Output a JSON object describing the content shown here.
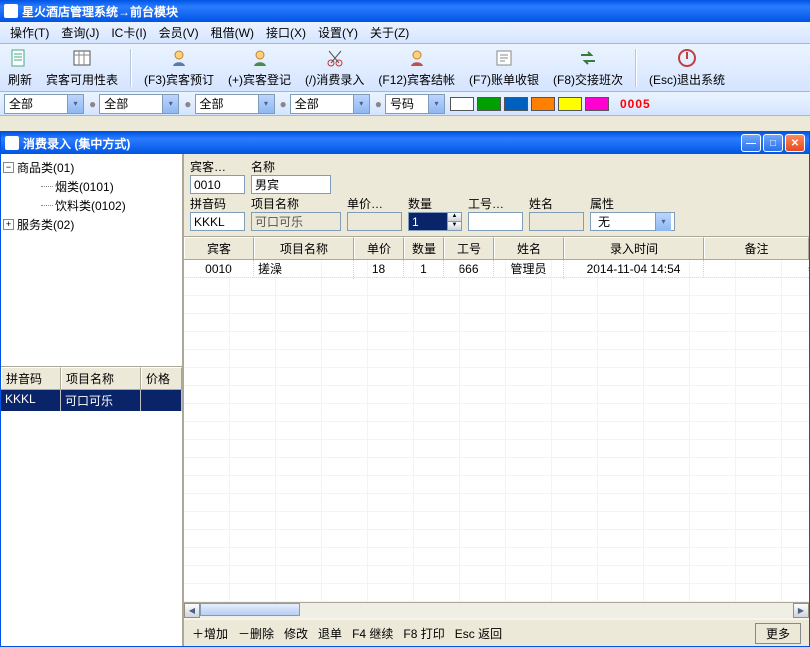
{
  "app": {
    "title": "星火酒店管理系统→前台模块"
  },
  "menu": {
    "operate": "操作(T)",
    "query": "查询(J)",
    "ic": "IC卡(I)",
    "member": "会员(V)",
    "rent": "租借(W)",
    "interface": "接口(X)",
    "setting": "设置(Y)",
    "about": "关于(Z)"
  },
  "toolbar": {
    "refresh": "刷新",
    "availability": "宾客可用性表",
    "reserve": "(F3)宾客预订",
    "checkin": "(+)宾客登记",
    "expenses": "(/)消费录入",
    "checkout": "(F12)宾客结帐",
    "billcollect": "(F7)账单收银",
    "shift": "(F8)交接班次",
    "exit": "(Esc)退出系统"
  },
  "filters": {
    "all1": "全部",
    "all2": "全部",
    "all3": "全部",
    "all4": "全部",
    "number": "号码",
    "counter": "0005"
  },
  "child": {
    "title": "消费录入 (集中方式)"
  },
  "tree": {
    "goods": "商品类(01)",
    "tobacco": "烟类(0101)",
    "drinks": "饮料类(0102)",
    "service": "服务类(02)"
  },
  "leftgrid": {
    "h_pinyin": "拼音码",
    "h_item": "项目名称",
    "h_price": "价格",
    "r1_pinyin": "KKKL",
    "r1_item": "可口可乐"
  },
  "form": {
    "guest_l": "宾客…",
    "guest_v": "0010",
    "name_l": "名称",
    "name_v": "男宾",
    "pinyin_l": "拼音码",
    "pinyin_v": "KKKL",
    "itemname_l": "项目名称",
    "itemname_v": "可口可乐",
    "price_l": "单价…",
    "price_v": "",
    "qty_l": "数量",
    "qty_v": "1",
    "jobno_l": "工号…",
    "jobno_v": "",
    "staff_l": "姓名",
    "staff_v": "",
    "attr_l": "属性",
    "attr_v": "无"
  },
  "grid": {
    "h_guest": "宾客",
    "h_item": "项目名称",
    "h_price": "单价",
    "h_qty": "数量",
    "h_job": "工号",
    "h_name": "姓名",
    "h_time": "录入时间",
    "h_note": "备注",
    "r1": {
      "guest": "0010",
      "item": "搓澡",
      "price": "18",
      "qty": "1",
      "job": "666",
      "name": "管理员",
      "time": "2014-11-04 14:54",
      "note": ""
    }
  },
  "status": {
    "add": "＋增加",
    "del": "－删除",
    "edit": "修改",
    "refund": "退单",
    "cont": "F4 继续",
    "print": "F8 打印",
    "back": "Esc 返回",
    "more": "更多"
  }
}
